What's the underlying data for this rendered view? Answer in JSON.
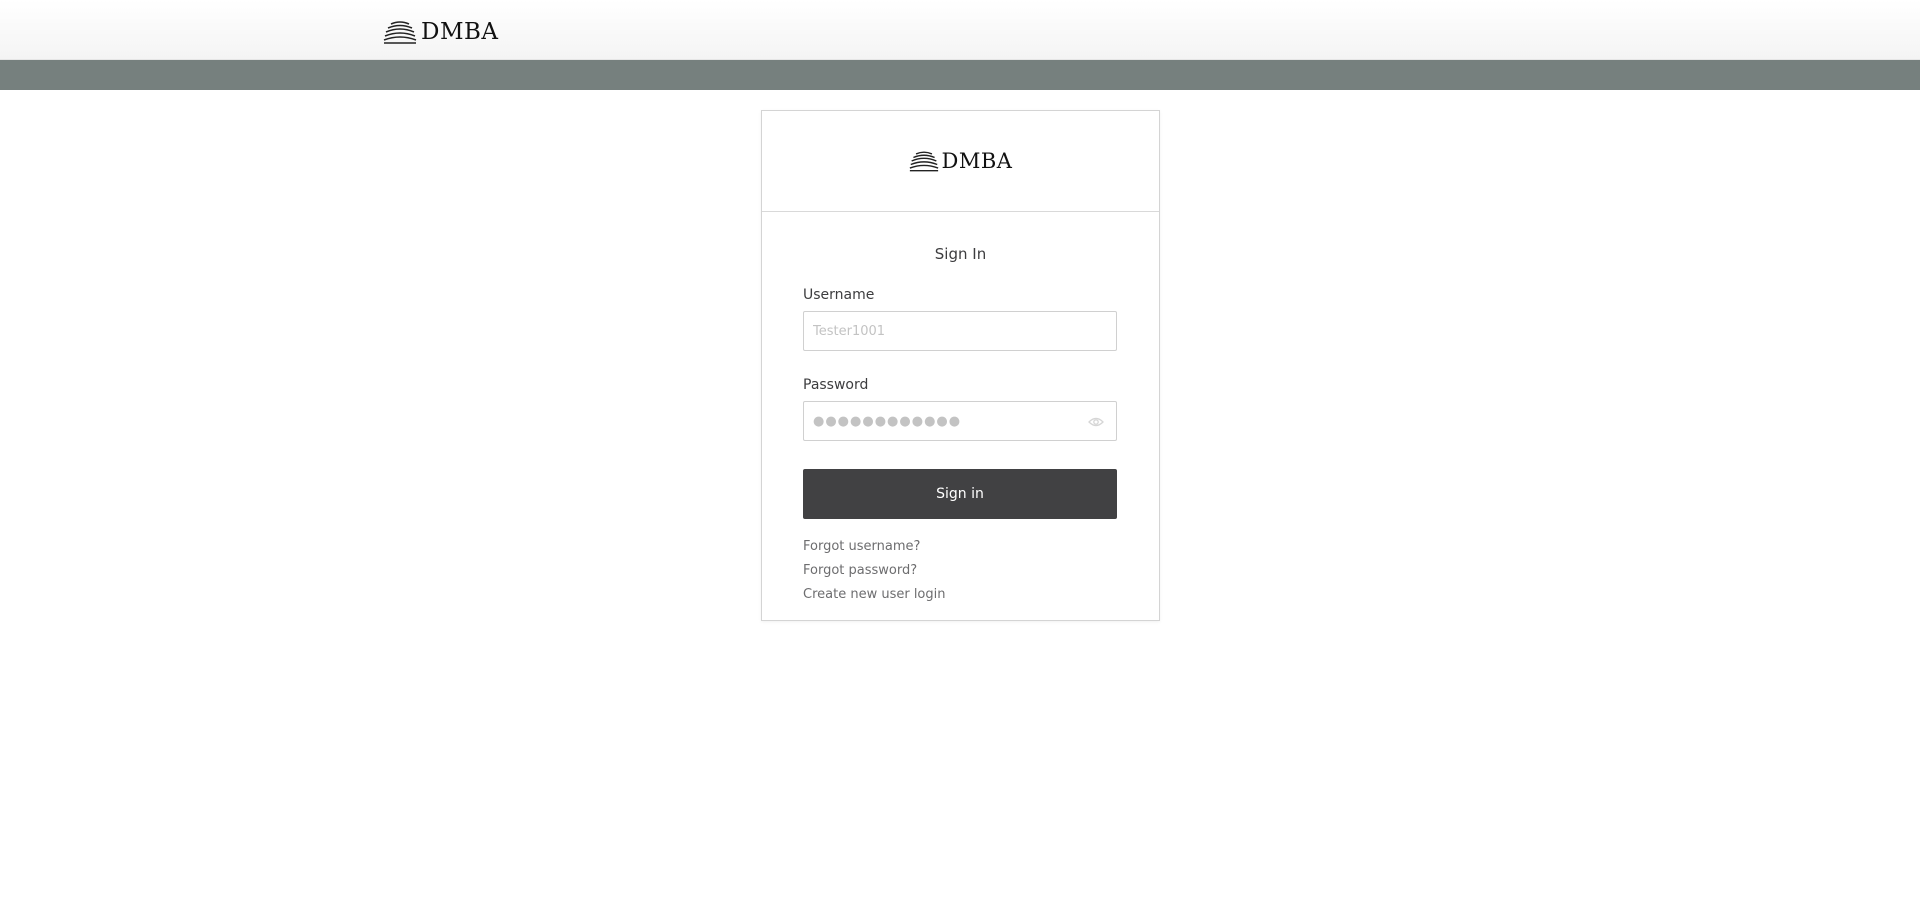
{
  "header": {
    "logo_text": "DMBA"
  },
  "card": {
    "logo_text": "DMBA",
    "title": "Sign In",
    "username": {
      "label": "Username",
      "placeholder": "Tester1001",
      "value": ""
    },
    "password": {
      "label": "Password",
      "placeholder": "●●●●●●●●●●●●",
      "value": ""
    },
    "signin_label": "Sign in",
    "links": {
      "forgot_username": "Forgot username?",
      "forgot_password": "Forgot password?",
      "create_login": "Create new user login"
    }
  },
  "colors": {
    "stripe": "#76807e",
    "button": "#414143",
    "link": "#6d6d6f"
  },
  "icons": {
    "logo": "dmba-arches-icon",
    "password_toggle": "eye-icon"
  }
}
